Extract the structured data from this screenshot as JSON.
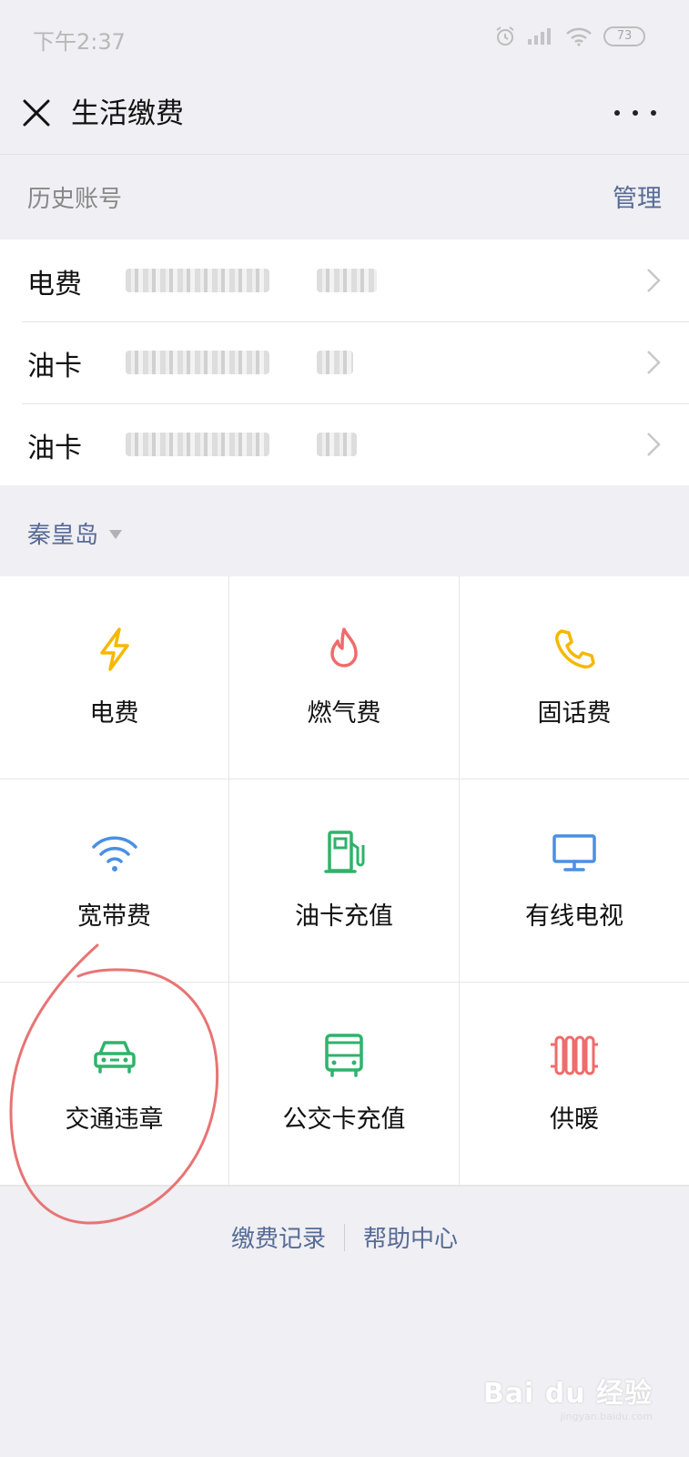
{
  "status_bar": {
    "time": "下午2:37",
    "battery": "73"
  },
  "nav": {
    "title": "生活缴费"
  },
  "history": {
    "label": "历史账号",
    "manage": "管理",
    "accounts": [
      {
        "type": "电费"
      },
      {
        "type": "油卡"
      },
      {
        "type": "油卡"
      }
    ]
  },
  "city": {
    "name": "秦皇岛"
  },
  "services": [
    {
      "label": "电费",
      "icon": "lightning-icon",
      "color": "#f5b800"
    },
    {
      "label": "燃气费",
      "icon": "flame-icon",
      "color": "#f06b6b"
    },
    {
      "label": "固话费",
      "icon": "phone-icon",
      "color": "#f5b800"
    },
    {
      "label": "宽带费",
      "icon": "wifi-icon",
      "color": "#4a90e2"
    },
    {
      "label": "油卡充值",
      "icon": "fuel-pump-icon",
      "color": "#2fb36a"
    },
    {
      "label": "有线电视",
      "icon": "monitor-icon",
      "color": "#4a90e2"
    },
    {
      "label": "交通违章",
      "icon": "car-icon",
      "color": "#2fb36a"
    },
    {
      "label": "公交卡充值",
      "icon": "bus-icon",
      "color": "#2fb36a"
    },
    {
      "label": "供暖",
      "icon": "radiator-icon",
      "color": "#f06b6b"
    }
  ],
  "footer": {
    "records": "缴费记录",
    "help": "帮助中心"
  },
  "watermark": {
    "main": "Bai du 经验",
    "sub": "jingyan.baidu.com"
  }
}
